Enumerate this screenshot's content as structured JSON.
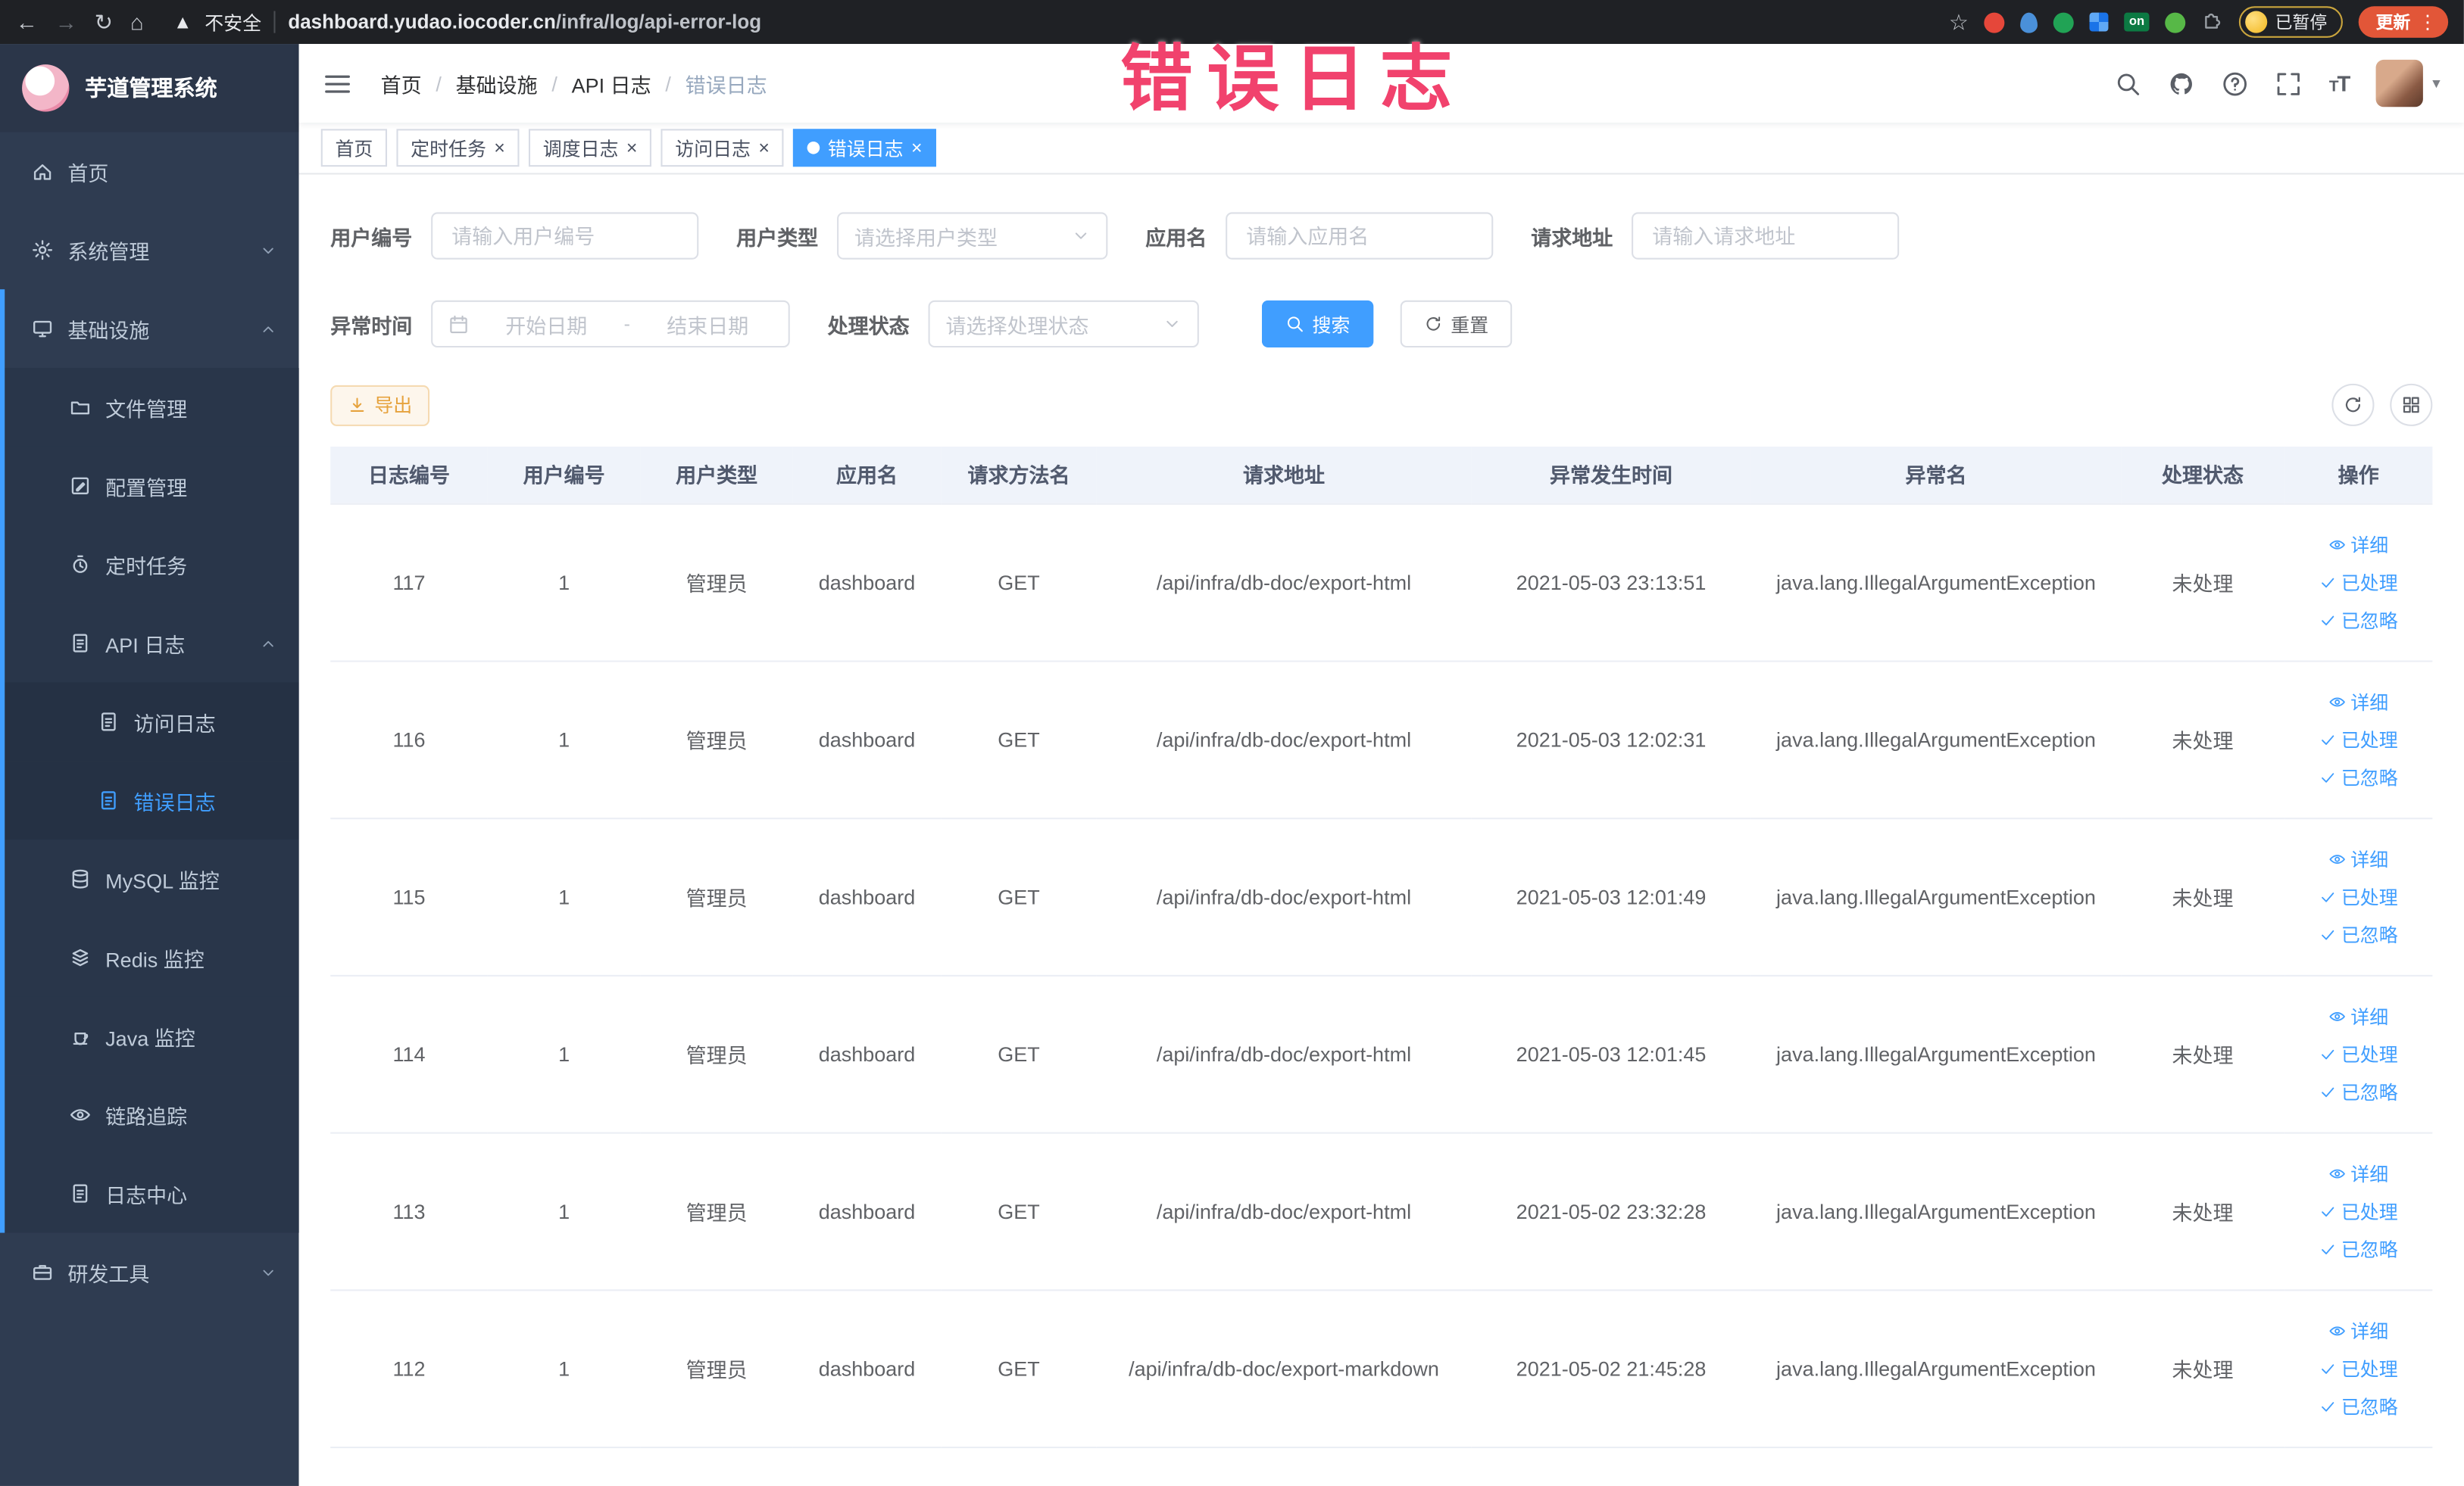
{
  "browser": {
    "security_label": "不安全",
    "url_domain": "dashboard.yudao.iocoder.cn",
    "url_path": "/infra/log/api-error-log",
    "paused_badge": "已暂停",
    "update_label": "更新"
  },
  "colors": {
    "accent": "#409eff",
    "watermark": "#f1426d",
    "warning": "#e6a23c",
    "sidebar_bg": "#2f3c51"
  },
  "sidebar": {
    "app_title": "芋道管理系统",
    "menu": [
      {
        "label": "首页"
      },
      {
        "label": "系统管理"
      },
      {
        "label": "基础设施"
      },
      {
        "label": "文件管理"
      },
      {
        "label": "配置管理"
      },
      {
        "label": "定时任务"
      },
      {
        "label": "API 日志"
      },
      {
        "label": "访问日志"
      },
      {
        "label": "错误日志"
      },
      {
        "label": "MySQL 监控"
      },
      {
        "label": "Redis 监控"
      },
      {
        "label": "Java 监控"
      },
      {
        "label": "链路追踪"
      },
      {
        "label": "日志中心"
      },
      {
        "label": "研发工具"
      }
    ]
  },
  "header": {
    "breadcrumb": [
      "首页",
      "基础设施",
      "API 日志",
      "错误日志"
    ],
    "watermark": "错误日志"
  },
  "tabs": [
    {
      "label": "首页"
    },
    {
      "label": "定时任务"
    },
    {
      "label": "调度日志"
    },
    {
      "label": "访问日志"
    },
    {
      "label": "错误日志"
    }
  ],
  "filters": {
    "user_id": {
      "label": "用户编号",
      "placeholder": "请输入用户编号"
    },
    "user_type": {
      "label": "用户类型",
      "placeholder": "请选择用户类型"
    },
    "app_name": {
      "label": "应用名",
      "placeholder": "请输入应用名"
    },
    "request_url": {
      "label": "请求地址",
      "placeholder": "请输入请求地址"
    },
    "exception_time": {
      "label": "异常时间",
      "start_placeholder": "开始日期",
      "separator": "-",
      "end_placeholder": "结束日期"
    },
    "process_status": {
      "label": "处理状态",
      "placeholder": "请选择处理状态"
    },
    "search_label": "搜索",
    "reset_label": "重置"
  },
  "toolbar": {
    "export_label": "导出"
  },
  "table": {
    "columns": [
      "日志编号",
      "用户编号",
      "用户类型",
      "应用名",
      "请求方法名",
      "请求地址",
      "异常发生时间",
      "异常名",
      "处理状态",
      "操作"
    ],
    "actions": {
      "detail": "详细",
      "processed": "已处理",
      "ignore": "已忽略"
    },
    "rows": [
      {
        "id": "117",
        "user_id": "1",
        "user_type": "管理员",
        "app": "dashboard",
        "method": "GET",
        "url": "/api/infra/db-doc/export-html",
        "time": "2021-05-03 23:13:51",
        "exception": "java.lang.IllegalArgumentException",
        "status": "未处理"
      },
      {
        "id": "116",
        "user_id": "1",
        "user_type": "管理员",
        "app": "dashboard",
        "method": "GET",
        "url": "/api/infra/db-doc/export-html",
        "time": "2021-05-03 12:02:31",
        "exception": "java.lang.IllegalArgumentException",
        "status": "未处理"
      },
      {
        "id": "115",
        "user_id": "1",
        "user_type": "管理员",
        "app": "dashboard",
        "method": "GET",
        "url": "/api/infra/db-doc/export-html",
        "time": "2021-05-03 12:01:49",
        "exception": "java.lang.IllegalArgumentException",
        "status": "未处理"
      },
      {
        "id": "114",
        "user_id": "1",
        "user_type": "管理员",
        "app": "dashboard",
        "method": "GET",
        "url": "/api/infra/db-doc/export-html",
        "time": "2021-05-03 12:01:45",
        "exception": "java.lang.IllegalArgumentException",
        "status": "未处理"
      },
      {
        "id": "113",
        "user_id": "1",
        "user_type": "管理员",
        "app": "dashboard",
        "method": "GET",
        "url": "/api/infra/db-doc/export-html",
        "time": "2021-05-02 23:32:28",
        "exception": "java.lang.IllegalArgumentException",
        "status": "未处理"
      },
      {
        "id": "112",
        "user_id": "1",
        "user_type": "管理员",
        "app": "dashboard",
        "method": "GET",
        "url": "/api/infra/db-doc/export-markdown",
        "time": "2021-05-02 21:45:28",
        "exception": "java.lang.IllegalArgumentException",
        "status": "未处理"
      }
    ]
  }
}
